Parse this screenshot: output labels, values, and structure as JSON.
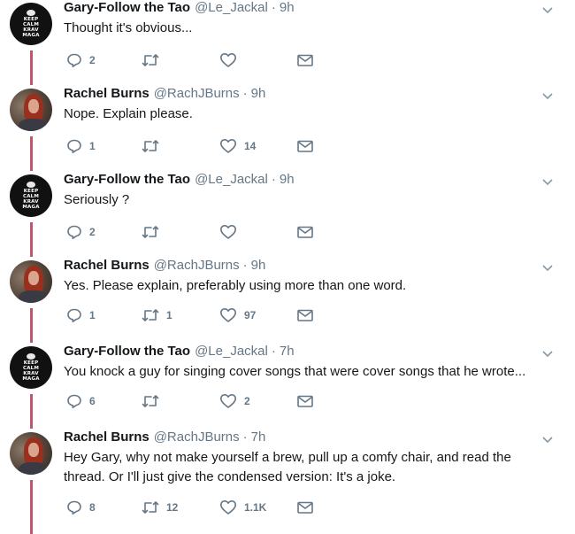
{
  "tweets": [
    {
      "author": "gary",
      "name": "Gary-Follow the Tao",
      "handle": "@Le_Jackal",
      "separator": "·",
      "time": "9h",
      "lines": [
        "Thought it's obvious..."
      ],
      "replies": "2",
      "retweets": "",
      "likes": "",
      "avatar_text": [
        "KEEP",
        "CALM",
        "KRAV",
        "MAGA"
      ]
    },
    {
      "author": "rachel",
      "name": "Rachel Burns",
      "handle": "@RachJBurns",
      "separator": "·",
      "time": "9h",
      "lines": [
        "Nope. Explain please."
      ],
      "replies": "1",
      "retweets": "",
      "likes": "14"
    },
    {
      "author": "gary",
      "name": "Gary-Follow the Tao",
      "handle": "@Le_Jackal",
      "separator": "·",
      "time": "9h",
      "lines": [
        "Seriously ?"
      ],
      "replies": "2",
      "retweets": "",
      "likes": "",
      "avatar_text": [
        "KEEP",
        "CALM",
        "KRAV",
        "MAGA"
      ]
    },
    {
      "author": "rachel",
      "name": "Rachel Burns",
      "handle": "@RachJBurns",
      "separator": "·",
      "time": "9h",
      "lines": [
        "Yes. Please explain, preferably using more than one word."
      ],
      "replies": "1",
      "retweets": "1",
      "likes": "97"
    },
    {
      "author": "gary",
      "name": "Gary-Follow the Tao",
      "handle": "@Le_Jackal",
      "separator": "·",
      "time": "7h",
      "lines": [
        "You knock a guy for singing cover songs that were cover songs that he wrote..."
      ],
      "replies": "6",
      "retweets": "",
      "likes": "2",
      "avatar_text": [
        "KEEP",
        "CALM",
        "KRAV",
        "MAGA"
      ]
    },
    {
      "author": "rachel",
      "name": "Rachel Burns",
      "handle": "@RachJBurns",
      "separator": "·",
      "time": "7h",
      "lines": [
        "Hey Gary, why not make yourself a brew, pull up a comfy chair, and read the",
        "thread. Or I'll just give the condensed version: It's a joke."
      ],
      "replies": "8",
      "retweets": "12",
      "likes": "1.1K"
    }
  ],
  "icons": {
    "reply": "reply-icon",
    "retweet": "retweet-icon",
    "like": "heart-icon",
    "dm": "envelope-icon",
    "more": "chevron-down-icon"
  },
  "colors": {
    "thread_line": "#c0566b",
    "muted": "#657786",
    "text": "#14171a"
  }
}
